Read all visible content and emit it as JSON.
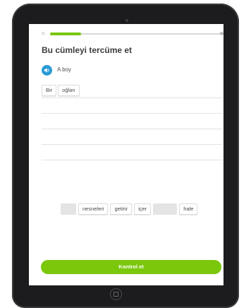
{
  "exercise": {
    "title": "Bu cümleyi tercüme et",
    "prompt": "A boy",
    "progress": 0.18,
    "close_glyph": "×"
  },
  "answer": {
    "words": [
      "Bir",
      "oğlan"
    ]
  },
  "word_bank": {
    "words": [
      "",
      "nesneleri",
      "getirir",
      "içer",
      "",
      "hale"
    ]
  },
  "actions": {
    "check_label": "Kontrol et"
  },
  "colors": {
    "accent_green": "#7ac70c",
    "speaker_blue": "#2b9bd6",
    "device_frame": "#1c1c1e"
  },
  "icons": {
    "close": "close-icon",
    "speaker": "speaker-icon",
    "home": "home-button-icon"
  }
}
